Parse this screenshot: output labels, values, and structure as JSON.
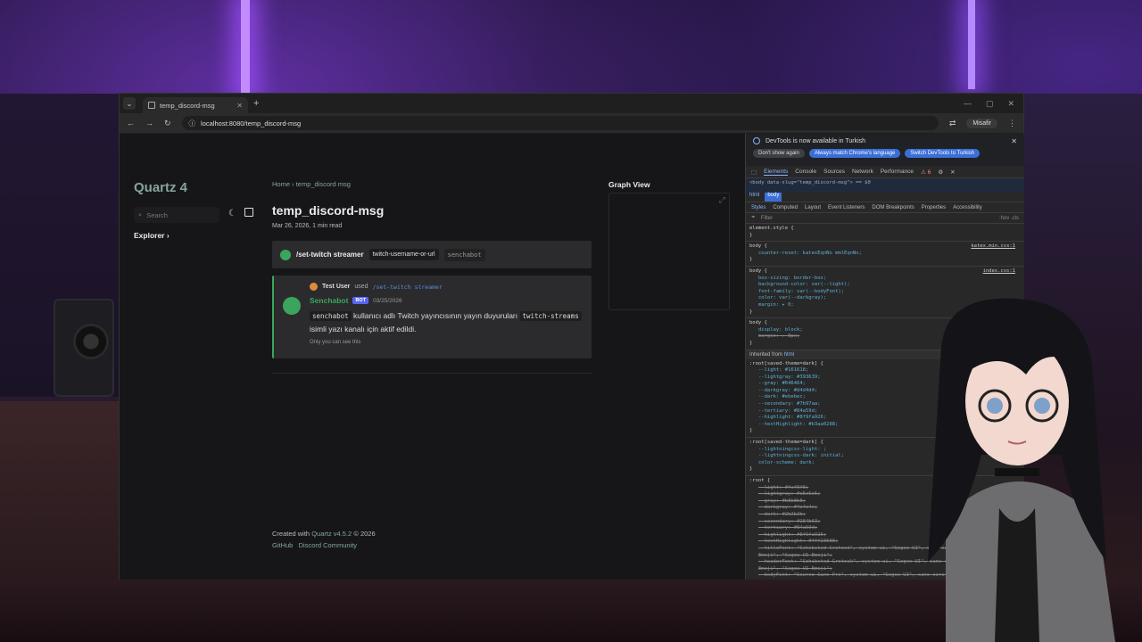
{
  "browser": {
    "tab_title": "temp_discord-msg",
    "url": "localhost:8080/temp_discord-msg",
    "profile": "Misafir"
  },
  "site": {
    "title": "Quartz 4",
    "search_placeholder": "Search",
    "explorer_label": "Explorer",
    "breadcrumb_home": "Home",
    "breadcrumb_current": "temp_discord msg",
    "page_title": "temp_discord-msg",
    "meta": "Mar 26, 2026, 1 min read",
    "graph_view": "Graph View",
    "footer_created": "Created with",
    "footer_quartz": "Quartz v4.5.2",
    "footer_year": "© 2026",
    "footer_links": [
      "GitHub",
      "Discord Community"
    ]
  },
  "discord": {
    "command": "/set-twitch streamer",
    "option_name": "twitch-username-or-url",
    "option_value": "senchabot",
    "reply_user": "Test User",
    "reply_used": "used",
    "reply_command": "/set-twitch streamer",
    "bot_name": "Senchabot",
    "bot_badge": "BOT",
    "date": "03/25/2026",
    "body_code1": "senchabot",
    "body_text1": "kullanıcı adlı Twitch yayıncısının yayın duyuruları",
    "body_code2": "twitch-streams",
    "body_text2": "isimli yazı kanalı için aktif edildi.",
    "only_you": "Only you can see this"
  },
  "devtools": {
    "banner_text": "DevTools is now available in Turkish",
    "banner_buttons": [
      "Don't show again",
      "Always match Chrome's language",
      "Switch DevTools to Turkish"
    ],
    "tabs": [
      "Elements",
      "Console",
      "Sources",
      "Network",
      "Performance"
    ],
    "warn_count": "6",
    "tree_line": "<body data-slug=\"temp_discord-msg\"> == $0",
    "crumbs": [
      "html",
      "body"
    ],
    "subtabs": [
      "Styles",
      "Computed",
      "Layout",
      "Event Listeners",
      "DOM Breakpoints",
      "Properties",
      "Accessibility"
    ],
    "filter_placeholder": "Filter",
    "filter_tools": ":hov .cls",
    "inherited_from": "Inherited from",
    "inherited_el": "html",
    "rules": [
      {
        "selector": "element.style {",
        "source": "",
        "props": []
      },
      {
        "selector": "body {",
        "source": "katex.min.css:1",
        "props": [
          "counter-reset: katexEqnNo mmlEqnNo;"
        ]
      },
      {
        "selector": "body {",
        "source": "index.css:1",
        "props": [
          "box-sizing: border-box;",
          "background-color: var(--light);",
          "font-family: var(--bodyFont);",
          "color: var(--darkgray);",
          "margin: ▸ 0;"
        ]
      },
      {
        "selector": "body {",
        "source": "user agent",
        "props": [
          "display: block;",
          "margin: ▸ 8px;"
        ]
      }
    ],
    "root_dark": [
      "--light: #161618;",
      "--lightgray: #393639;",
      "--gray: #646464;",
      "--darkgray: #d4d4d4;",
      "--dark: #ebebec;",
      "--secondary: #7b97aa;",
      "--tertiary: #84a59d;",
      "--highlight: #8f9fa926;",
      "--textHighlight: #b3aa0288;"
    ],
    "root_dark2": [
      "--lightningcss-light: ;",
      "--lightningcss-dark: initial;",
      "color-scheme: dark;"
    ],
    "root": [
      "--light: #faf8f8;",
      "--lightgray: #e5e5e5;",
      "--gray: #b8b8b8;",
      "--darkgray: #4e4e4e;",
      "--dark: #2b2b2b;",
      "--secondary: #284b63;",
      "--tertiary: #84a59d;",
      "--highlight: #8f9fa926;",
      "--textHighlight: #fff23688;",
      "--titleFont: \"Schibsted Grotesk\", system-ui, \"Segoe UI\", sans-serif, \"Apple Color Emoji\", \"Segoe UI Emoji\";",
      "--headerFont: \"Schibsted Grotesk\", system-ui, \"Segoe UI\", sans-serif, \"Apple Color Emoji\", \"Segoe UI Emoji\";",
      "--bodyFont: \"Source Sans Pro\", system-ui, \"Segoe UI\", sans-serif, \"Apple Color Emoji\", \"Segoe UI Emoji\";"
    ]
  },
  "colors": {
    "accent": "#84a59d",
    "bot_green": "#3ba55d",
    "page_bg": "#161618"
  }
}
